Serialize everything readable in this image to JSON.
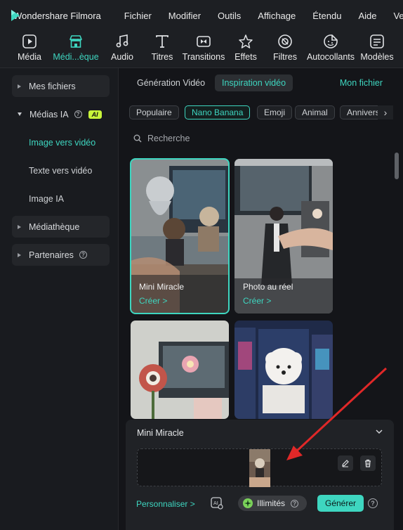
{
  "app": {
    "title": "Wondershare Filmora"
  },
  "menu": [
    "Fichier",
    "Modifier",
    "Outils",
    "Affichage",
    "Étendu",
    "Aide",
    "Vers"
  ],
  "toolbar": {
    "items": [
      {
        "label": "Média",
        "icon": "media-icon"
      },
      {
        "label": "Médi...èque",
        "icon": "store-icon",
        "active": true
      },
      {
        "label": "Audio",
        "icon": "music-note-icon"
      },
      {
        "label": "Titres",
        "icon": "text-t-icon"
      },
      {
        "label": "Transitions",
        "icon": "transition-icon"
      },
      {
        "label": "Effets",
        "icon": "sparkle-star-icon"
      },
      {
        "label": "Filtres",
        "icon": "filter-icon"
      },
      {
        "label": "Autocollants",
        "icon": "sticker-icon"
      },
      {
        "label": "Modèles",
        "icon": "template-icon"
      }
    ]
  },
  "sidebar": {
    "mes_fichiers": "Mes fichiers",
    "medias_ia": "Médias IA",
    "ai_badge": "AI",
    "sub": [
      "Image vers vidéo",
      "Texte vers vidéo",
      "Image IA"
    ],
    "mediatheque": "Médiathèque",
    "partenaires": "Partenaires",
    "help": "?"
  },
  "tabs": {
    "generation": "Génération Vidéo",
    "inspiration": "Inspiration vidéo",
    "my_file": "Mon fichier"
  },
  "chips": [
    "Populaire",
    "Nano Banana",
    "Emoji",
    "Animal",
    "Annivers"
  ],
  "chip_arrow": "›",
  "search": {
    "placeholder": "Recherche"
  },
  "cards": [
    {
      "title": "Mini Miracle",
      "cta": "Créer  >"
    },
    {
      "title": "Photo au réel",
      "cta": "Créer  >"
    }
  ],
  "panel": {
    "title": "Mini Miracle",
    "personalize": "Personnaliser >",
    "credits": "Illimités",
    "generate": "Générer",
    "help": "?"
  },
  "colors": {
    "accent": "#3ed6c0",
    "ai_badge": "#c8f53a",
    "annotation": "#e02828"
  }
}
